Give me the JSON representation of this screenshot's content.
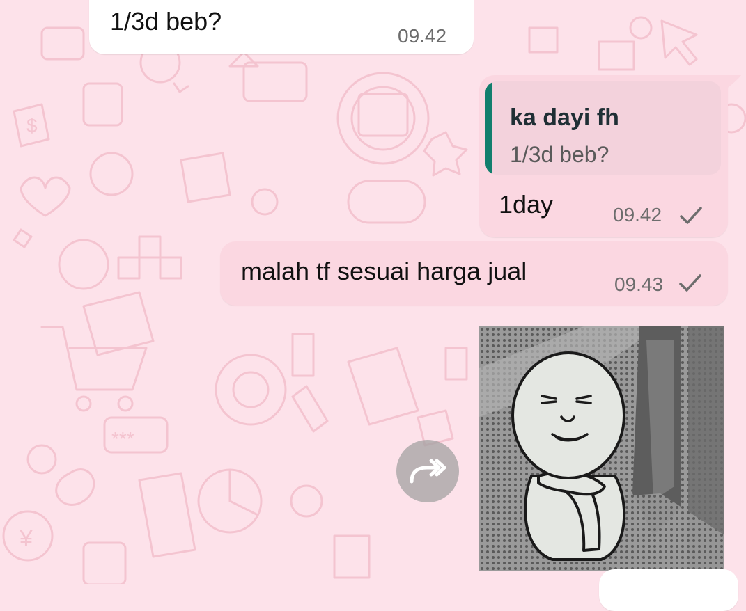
{
  "colors": {
    "wallpaper": "#fde2ea",
    "incoming_bubble": "#ffffff",
    "outgoing_bubble": "#fbd7e1",
    "quote_accent": "#127e6d",
    "tick": "#6d6d6d"
  },
  "messages": [
    {
      "direction": "incoming",
      "text": "1/3d beb?",
      "time": "09.42"
    },
    {
      "direction": "outgoing",
      "quote": {
        "sender": "ka dayi fh",
        "text": "1/3d beb?"
      },
      "text": "1day",
      "time": "09.42",
      "status": "sent-check-icon"
    },
    {
      "direction": "outgoing",
      "text": "malah tf sesuai harga jual",
      "time": "09.43",
      "status": "sent-check-icon"
    },
    {
      "direction": "outgoing",
      "type": "sticker",
      "sticker_icon": "crying-cartoon-sticker"
    }
  ],
  "actions": {
    "forward_icon": "forward-icon"
  }
}
